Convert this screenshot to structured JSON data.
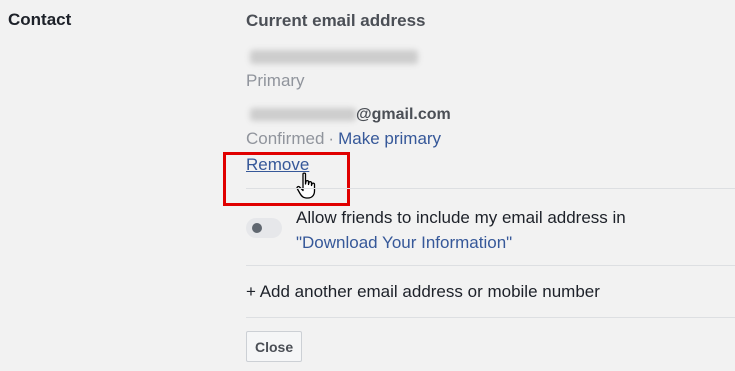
{
  "section": {
    "label": "Contact"
  },
  "email": {
    "heading": "Current email address",
    "primary_label": "Primary",
    "second_domain": "@gmail.com",
    "second_status": "Confirmed",
    "separator": "·",
    "make_primary": "Make primary",
    "remove": "Remove"
  },
  "privacy": {
    "allow_text": "Allow friends to include my email address in",
    "allow_link": "\"Download Your Information\"",
    "toggle_on": false
  },
  "actions": {
    "add_another": "+ Add another email address or mobile number",
    "close": "Close"
  },
  "colors": {
    "link": "#365899",
    "highlight": "#e00000",
    "muted": "#90949c"
  }
}
